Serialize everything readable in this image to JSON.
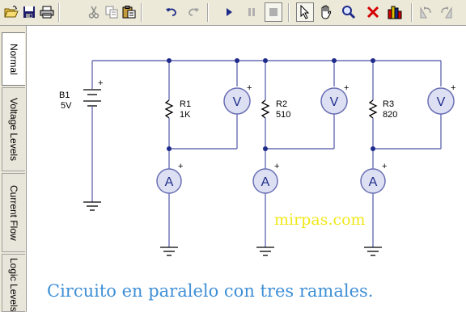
{
  "toolbar": {
    "buttons": [
      {
        "name": "open-file-button",
        "icon": "folder-open-icon"
      },
      {
        "name": "save-button",
        "icon": "floppy-disk-icon"
      },
      {
        "name": "print-button",
        "icon": "printer-icon"
      },
      {
        "name": "cut-button",
        "icon": "scissors-icon"
      },
      {
        "name": "copy-button",
        "icon": "copy-icon"
      },
      {
        "name": "paste-button",
        "icon": "clipboard-icon"
      },
      {
        "name": "undo-button",
        "icon": "undo-icon"
      },
      {
        "name": "redo-button",
        "icon": "redo-icon"
      },
      {
        "name": "run-button",
        "icon": "play-icon"
      },
      {
        "name": "pause-button",
        "icon": "pause-icon"
      },
      {
        "name": "stop-button",
        "icon": "stop-icon"
      },
      {
        "name": "select-tool-button",
        "icon": "arrow-cursor-icon"
      },
      {
        "name": "pan-tool-button",
        "icon": "hand-icon"
      },
      {
        "name": "zoom-tool-button",
        "icon": "magnifier-icon"
      },
      {
        "name": "delete-button",
        "icon": "red-x-icon"
      },
      {
        "name": "parts-bin-button",
        "icon": "bar-chart-icon"
      },
      {
        "name": "rotate-left-button",
        "icon": "rotate-left-icon"
      },
      {
        "name": "rotate-right-button",
        "icon": "rotate-right-icon"
      }
    ]
  },
  "sidebar": {
    "tabs": [
      {
        "label": "Normal",
        "active": true
      },
      {
        "label": "Voltage Levels",
        "active": false
      },
      {
        "label": "Current Flow",
        "active": false
      },
      {
        "label": "Logic Levels",
        "active": false
      }
    ]
  },
  "circuit": {
    "battery": {
      "name": "B1",
      "value": "5V",
      "plus": "+"
    },
    "resistors": [
      {
        "name": "R1",
        "value": "1K"
      },
      {
        "name": "R2",
        "value": "510"
      },
      {
        "name": "R3",
        "value": "820"
      }
    ],
    "voltmeter_symbol": "V",
    "ammeter_symbol": "A",
    "meter_plus": "+"
  },
  "watermark": "mirpas.com",
  "caption": "Circuito en paralelo con tres ramales.",
  "colors": {
    "wire": "#6a6fb4",
    "meter_fill": "#dde0f3",
    "meter_ring": "#6a6fb4",
    "caption": "#3f8fd6",
    "watermark": "#f0e81a",
    "chrome": "#ece9d8"
  }
}
